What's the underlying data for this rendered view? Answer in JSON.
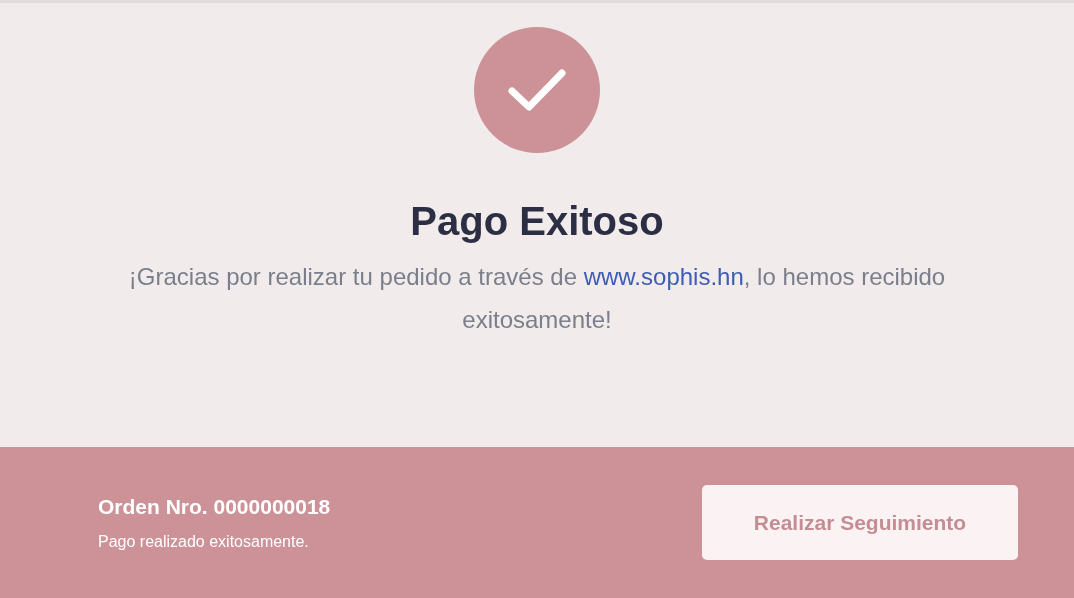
{
  "status": {
    "title": "Pago Exitoso",
    "message_before": "¡Gracias por realizar tu pedido a través de ",
    "link": "www.sophis.hn",
    "message_after": ", lo hemos recibido exitosamente!"
  },
  "footer": {
    "order": "Orden Nro. 0000000018",
    "note": "Pago realizado exitosamente.",
    "button": "Realizar Seguimiento"
  }
}
